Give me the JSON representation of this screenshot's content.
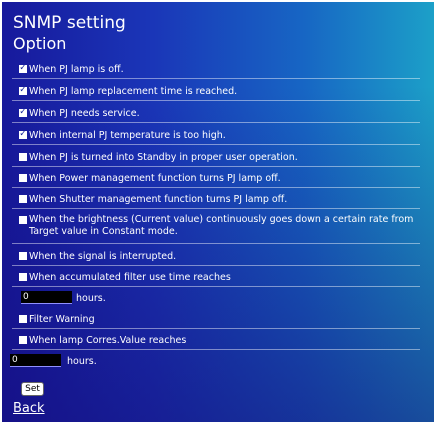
{
  "header": {
    "title": "SNMP setting",
    "section": "Option"
  },
  "options": [
    {
      "label": "When PJ lamp is off.",
      "checked": true
    },
    {
      "label": "When PJ lamp replacement time is reached.",
      "checked": true
    },
    {
      "label": "When PJ needs service.",
      "checked": true
    },
    {
      "label": "When internal PJ temperature is too high.",
      "checked": true
    },
    {
      "label": "When PJ is turned into Standby in proper user operation.",
      "checked": false
    },
    {
      "label": "When Power management function turns PJ lamp off.",
      "checked": false
    },
    {
      "label": "When Shutter management function turns PJ lamp off.",
      "checked": false
    },
    {
      "label": "When the brightness (Current value) continuously goes down a certain rate from Target value in Constant mode.",
      "checked": false
    },
    {
      "label": "When the signal is interrupted.",
      "checked": false
    },
    {
      "label": "When accumulated filter use time reaches",
      "checked": false
    },
    {
      "label": "Filter Warning",
      "checked": false
    },
    {
      "label": "When lamp Corres.Value reaches",
      "checked": false
    }
  ],
  "filter_hours": {
    "value": "0",
    "unit": "hours."
  },
  "lamp_hours": {
    "value": "0",
    "unit": "hours."
  },
  "buttons": {
    "set": "Set",
    "back": "Back"
  },
  "colors": {
    "check": "#1a2a9c",
    "input_bg": "#000000"
  }
}
